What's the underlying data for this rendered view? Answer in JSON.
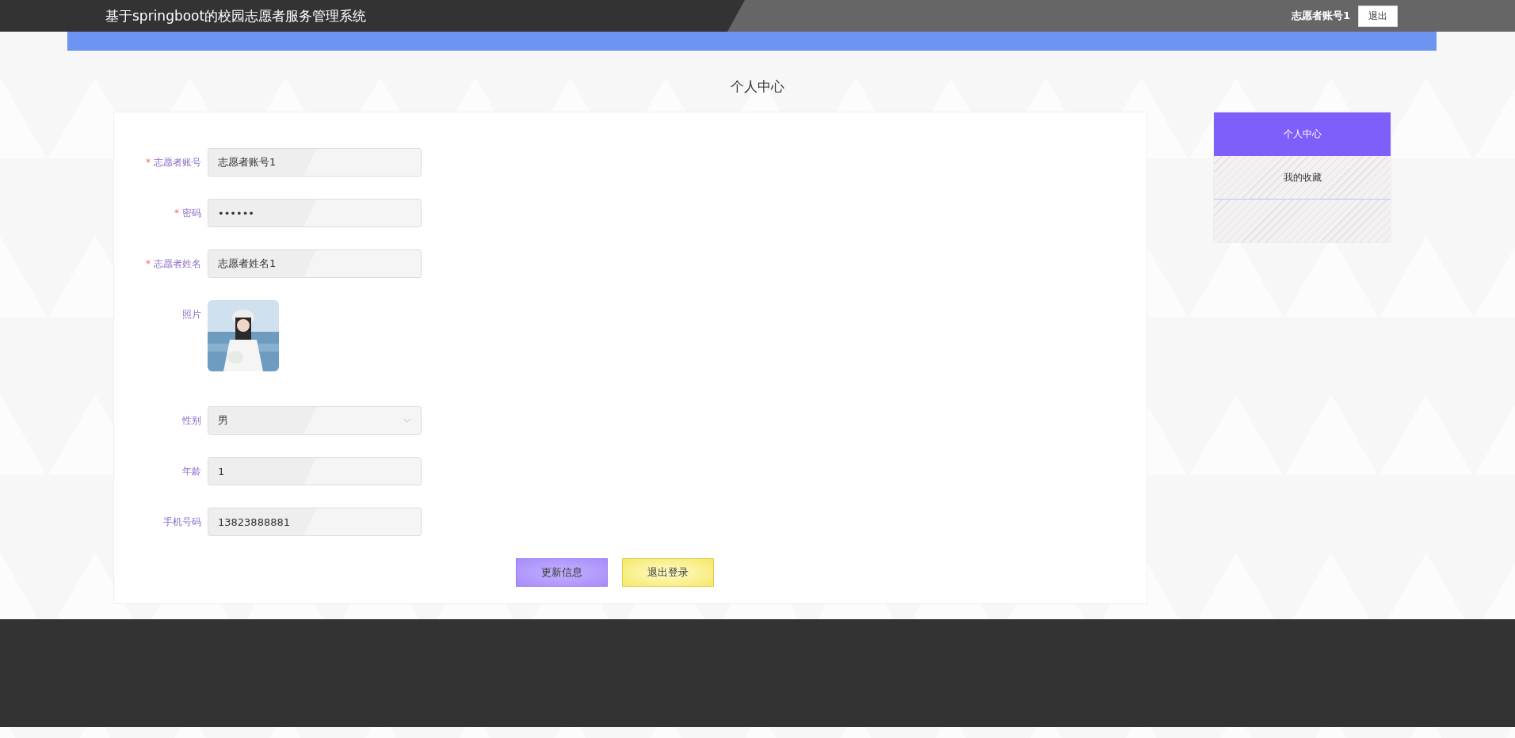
{
  "header": {
    "title": "基于springboot的校园志愿者服务管理系统",
    "user": "志愿者账号1",
    "logout": "退出"
  },
  "page_title": "个人中心",
  "form": {
    "fields": [
      {
        "kind": "input",
        "required_mark": "*",
        "label": "志愿者账号",
        "value": "志愿者账号1"
      },
      {
        "kind": "input",
        "required_mark": "*",
        "label": "密码",
        "value": "••••••"
      },
      {
        "kind": "input",
        "required_mark": "*",
        "label": "志愿者姓名",
        "value": "志愿者姓名1"
      },
      {
        "label": "照片"
      },
      {
        "kind": "select",
        "label": "性别",
        "value": "男"
      },
      {
        "kind": "input",
        "label": "年龄",
        "value": "1"
      },
      {
        "kind": "input",
        "label": "手机号码",
        "value": "13823888881"
      }
    ],
    "buttons": [
      {
        "label": "更新信息",
        "kind": "primary"
      },
      {
        "label": "退出登录",
        "kind": "secondary"
      }
    ]
  },
  "sidebar": {
    "items": [
      {
        "label": "个人中心",
        "selected": true
      },
      {
        "label": "我的收藏",
        "selected": false
      },
      {
        "selected": false
      }
    ]
  }
}
